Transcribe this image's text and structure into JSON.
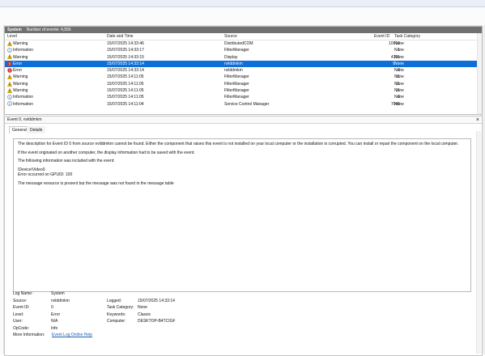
{
  "log_panel": {
    "log_name": "System",
    "event_count_label": "Number of events: 4,556",
    "columns": {
      "level": "Level",
      "date_time": "Date and Time",
      "source": "Source",
      "event_id": "Event ID",
      "task_category": "Task Category"
    },
    "rows": [
      {
        "level": "Warning",
        "icon": "warning-icon",
        "date": "15/07/2025 14:33:46",
        "source": "DistributedCOM",
        "event_id": "10016",
        "task": "None",
        "selected": false
      },
      {
        "level": "Information",
        "icon": "info-icon",
        "date": "15/07/2025 14:33:17",
        "source": "FilterManager",
        "event_id": "1",
        "task": "None",
        "selected": false
      },
      {
        "level": "Warning",
        "icon": "warning-icon",
        "date": "15/07/2025 14:33:15",
        "source": "Display",
        "event_id": "4101",
        "task": "None",
        "selected": false
      },
      {
        "level": "Error",
        "icon": "error-icon",
        "date": "15/07/2025 14:33:14",
        "source": "nvlddmkm",
        "event_id": "0",
        "task": "None",
        "selected": true
      },
      {
        "level": "Error",
        "icon": "error-icon",
        "date": "15/07/2025 14:33:14",
        "source": "nvlddmkm",
        "event_id": "0",
        "task": "None",
        "selected": false
      },
      {
        "level": "Warning",
        "icon": "warning-icon",
        "date": "15/07/2025 14:11:05",
        "source": "FilterManager",
        "event_id": "11",
        "task": "None",
        "selected": false
      },
      {
        "level": "Warning",
        "icon": "warning-icon",
        "date": "15/07/2025 14:11:05",
        "source": "FilterManager",
        "event_id": "11",
        "task": "None",
        "selected": false
      },
      {
        "level": "Warning",
        "icon": "warning-icon",
        "date": "15/07/2025 14:11:05",
        "source": "FilterManager",
        "event_id": "11",
        "task": "None",
        "selected": false
      },
      {
        "level": "Information",
        "icon": "info-icon",
        "date": "15/07/2025 14:11:05",
        "source": "FilterManager",
        "event_id": "6",
        "task": "None",
        "selected": false
      },
      {
        "level": "Information",
        "icon": "info-icon",
        "date": "15/07/2025 14:11:04",
        "source": "Service Control Manager",
        "event_id": "7045",
        "task": "None",
        "selected": false
      }
    ]
  },
  "detail": {
    "title": "Event 0, nvlddmkm",
    "close_glyph": "×",
    "tabs": {
      "general": "General",
      "details": "Details"
    },
    "description": [
      "The description for Event ID 0 from source nvlddmkm cannot be found. Either the component that raises this event is not installed on your local computer or the installation is corrupted. You can install or repair the component on the local computer.",
      "If the event originated on another computer, the display information had to be saved with the event.",
      "The following information was included with the event:",
      "\\Device\\Video0",
      "Error occurred on GPUID: 100",
      "The message resource is present but the message was not found in the message table"
    ],
    "props": {
      "log_name_label": "Log Name:",
      "log_name": "System",
      "source_label": "Source:",
      "source": "nvlddmkm",
      "logged_label": "Logged:",
      "logged": "15/07/2025 14:33:14",
      "event_id_label": "Event ID:",
      "event_id": "0",
      "task_category_label": "Task Category:",
      "task_category": "None",
      "level_label": "Level:",
      "level": "Error",
      "keywords_label": "Keywords:",
      "keywords": "Classic",
      "user_label": "User:",
      "user": "N/A",
      "computer_label": "Computer:",
      "computer": "DESKTOP-B4TCIGF",
      "opcode_label": "OpCode:",
      "opcode": "Info",
      "more_info_label": "More Information:",
      "more_info_link": "Event Log Online Help"
    }
  },
  "colors": {
    "selected_row": "#0f6fd8",
    "panel_header": "#707070",
    "warning": "#f2c200",
    "error": "#d32f2f",
    "info": "#3a6fb0"
  }
}
